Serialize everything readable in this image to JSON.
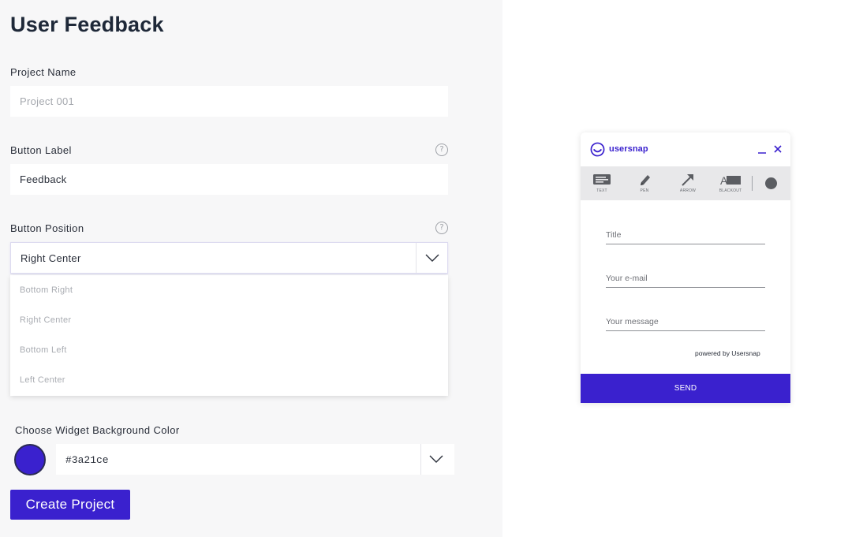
{
  "page": {
    "title": "User Feedback"
  },
  "form": {
    "project_name": {
      "label": "Project Name",
      "value": "",
      "placeholder": "Project 001"
    },
    "button_label": {
      "label": "Button Label",
      "value": "Feedback",
      "help_icon": "question-circle-icon"
    },
    "button_position": {
      "label": "Button Position",
      "selected": "Right Center",
      "help_icon": "question-circle-icon",
      "options": [
        "Bottom Right",
        "Right Center",
        "Bottom Left",
        "Left Center"
      ]
    },
    "background_color": {
      "label": "Choose Widget Background Color",
      "value": "#3a21ce",
      "swatch_color": "#3a21ce"
    },
    "create_button": "Create Project"
  },
  "widget": {
    "brand": "usersnap",
    "brand_color": "#3a21ce",
    "tools": [
      {
        "label": "TEXT",
        "icon": "text-comment-icon"
      },
      {
        "label": "PEN",
        "icon": "pen-icon"
      },
      {
        "label": "ARROW",
        "icon": "arrow-icon"
      },
      {
        "label": "BLACKOUT",
        "icon": "blackout-icon"
      }
    ],
    "fields": {
      "title": "Title",
      "email": "Your e-mail",
      "message": "Your message"
    },
    "powered_by": "powered by Usersnap",
    "send_label": "SEND"
  },
  "colors": {
    "accent": "#3a21ce",
    "panel_bg": "#f7f7f8"
  }
}
